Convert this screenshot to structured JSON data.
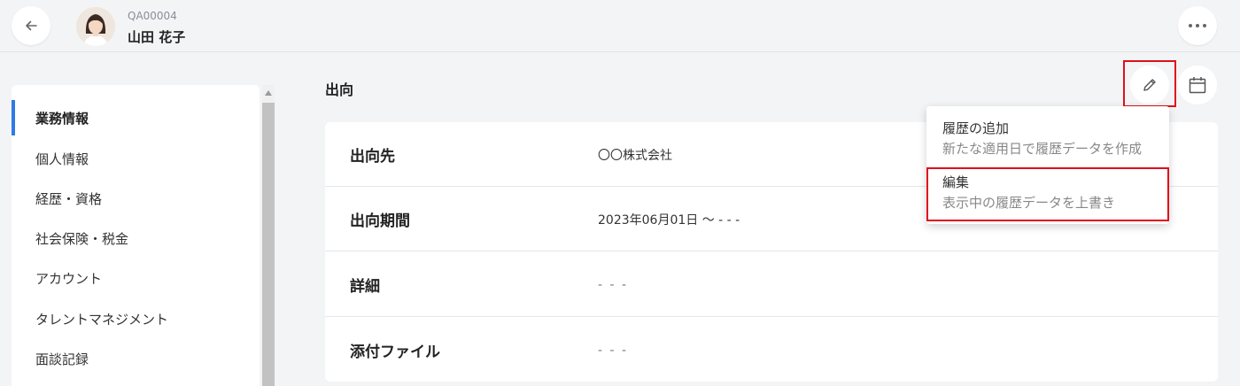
{
  "header": {
    "employee_code": "QA00004",
    "employee_name": "山田 花子",
    "back_icon": "arrow-left-icon",
    "more_icon": "ellipsis-icon"
  },
  "sidebar": {
    "items": [
      {
        "label": "業務情報",
        "active": true
      },
      {
        "label": "個人情報",
        "active": false
      },
      {
        "label": "経歴・資格",
        "active": false
      },
      {
        "label": "社会保険・税金",
        "active": false
      },
      {
        "label": "アカウント",
        "active": false
      },
      {
        "label": "タレントマネジメント",
        "active": false
      },
      {
        "label": "面談記録",
        "active": false
      }
    ],
    "accent_color": "#2f7be5"
  },
  "section": {
    "title": "出向",
    "edit_icon": "pencil-icon",
    "calendar_icon": "calendar-icon"
  },
  "details": {
    "rows": [
      {
        "label": "出向先",
        "value": "〇〇株式会社"
      },
      {
        "label": "出向期間",
        "value": "2023年06月01日 〜 - - -"
      },
      {
        "label": "詳細",
        "value": "- - -"
      },
      {
        "label": "添付ファイル",
        "value": "- - -"
      }
    ]
  },
  "dropdown": {
    "items": [
      {
        "title": "履歴の追加",
        "description": "新たな適用日で履歴データを作成"
      },
      {
        "title": "編集",
        "description": "表示中の履歴データを上書き"
      }
    ],
    "highlight_color": "#e0101a"
  }
}
